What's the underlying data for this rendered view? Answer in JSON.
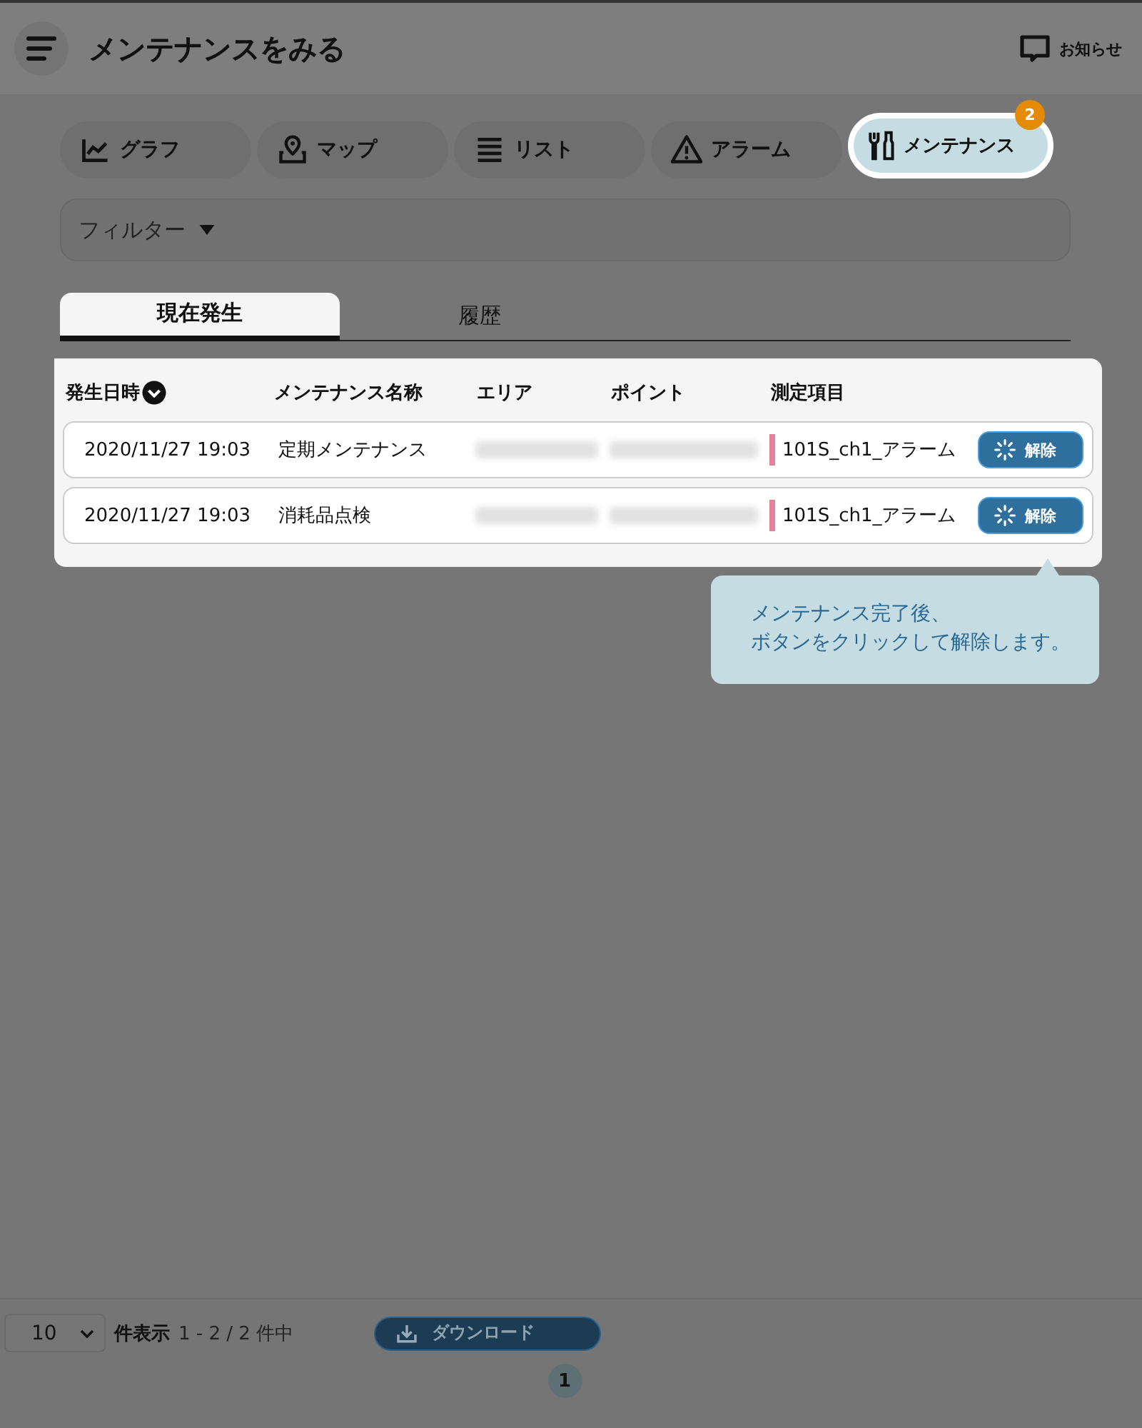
{
  "header": {
    "title": "メンテナンスをみる",
    "notice_label": "お知らせ"
  },
  "nav_tabs": [
    {
      "kind": "graph",
      "label": "グラフ",
      "selected": false
    },
    {
      "kind": "map",
      "label": "マップ",
      "selected": false
    },
    {
      "kind": "list",
      "label": "リスト",
      "selected": false
    },
    {
      "kind": "alarm",
      "label": "アラーム",
      "selected": false
    },
    {
      "kind": "maintenance",
      "label": "メンテナンス",
      "selected": true,
      "badge": "2"
    }
  ],
  "filter": {
    "label": "フィルター"
  },
  "sub_tabs": [
    {
      "label": "現在発生",
      "selected": true
    },
    {
      "label": "履歴",
      "selected": false
    }
  ],
  "table": {
    "columns": [
      "発生日時",
      "メンテナンス名称",
      "エリア",
      "ポイント",
      "測定項目"
    ],
    "rows": [
      {
        "date": "2020/11/27 19:03",
        "name": "定期メンテナンス",
        "measurement": "101S_ch1_アラーム",
        "button": "解除"
      },
      {
        "date": "2020/11/27 19:03",
        "name": "消耗品点検",
        "measurement": "101S_ch1_アラーム",
        "button": "解除"
      }
    ]
  },
  "tooltip": {
    "lines": [
      "メンテナンス完了後、",
      "ボタンをクリックして解除します。"
    ]
  },
  "footer": {
    "page_size": "10",
    "page_size_label": "件表示",
    "range": "1 - 2 / 2 件中",
    "download": "ダウンロード",
    "pages": [
      {
        "label": "1",
        "selected": true
      }
    ]
  }
}
